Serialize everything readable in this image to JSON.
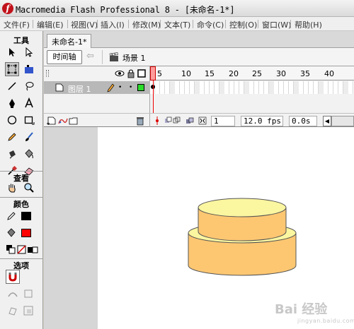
{
  "window": {
    "title": "Macromedia Flash Professional 8 - [未命名-1*]",
    "app_icon_letter": "f"
  },
  "menu": {
    "items": [
      "文件(F)",
      "编辑(E)",
      "视图(V)",
      "插入(I)",
      "修改(M)",
      "文本(T)",
      "命令(C)",
      "控制(O)",
      "窗口(W)",
      "帮助(H)"
    ]
  },
  "tools_panel": {
    "header": "工具",
    "section_view": "查看",
    "section_colors": "颜色",
    "section_options": "选项",
    "stroke_color": "#000000",
    "fill_color": "#ff0000"
  },
  "document": {
    "tab_label": "未命名-1*"
  },
  "scene_bar": {
    "timeline_button": "时间轴",
    "scene_label": "场景 1"
  },
  "timeline": {
    "layer_name": "图层 1",
    "layer_color": "#2bdc2b",
    "ruler_numbers": [
      "1",
      "5",
      "10",
      "15",
      "20",
      "25",
      "30",
      "35",
      "40"
    ],
    "current_frame": "1",
    "frame_rate": "12.0 fps",
    "elapsed_time": "0.0s"
  },
  "colors": {
    "cake_fill": "#fdc772",
    "cake_top": "#fbf6a0",
    "outline": "#555555",
    "stage_bg": "#ffffff",
    "pasteboard": "#d6d6d6"
  },
  "watermark": {
    "text": "Bai 经验",
    "sub": "jingyan.baidu.com"
  }
}
